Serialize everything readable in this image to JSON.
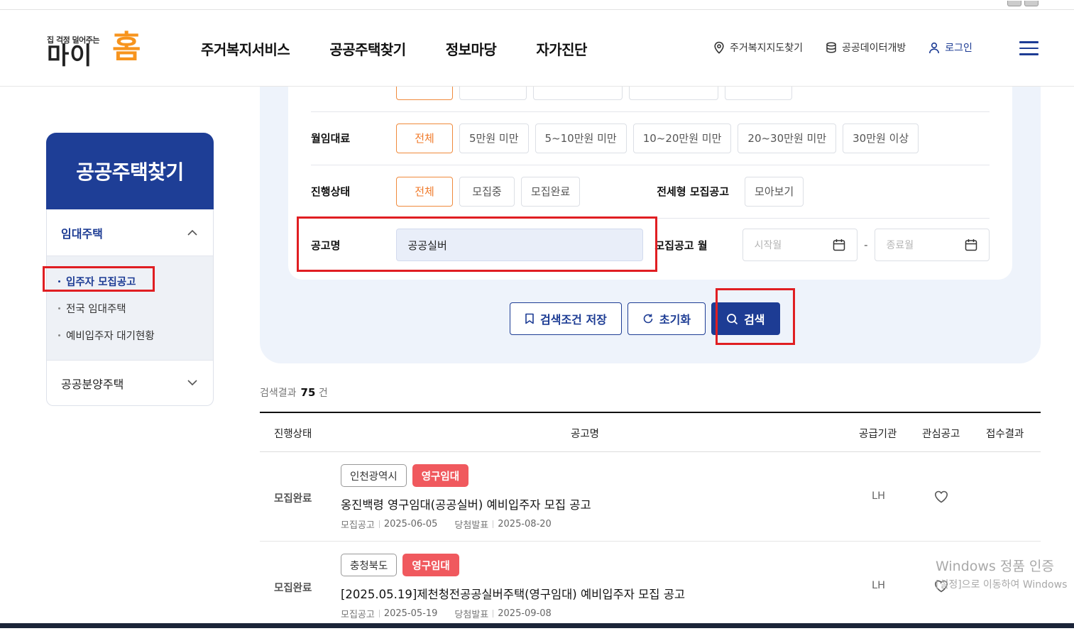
{
  "header": {
    "logo_small": "집 걱정 덜어주는",
    "logo_main": "마이",
    "logo_accent": "홈",
    "nav": [
      "주거복지서비스",
      "공공주택찾기",
      "정보마당",
      "자가진단"
    ],
    "util": {
      "map": "주거복지지도찾기",
      "data": "공공데이터개방",
      "login": "로그인"
    }
  },
  "sidebar": {
    "title": "공공주택찾기",
    "section1": "임대주택",
    "items": [
      "입주자 모집공고",
      "전국 임대주택",
      "예비입주자 대기현황"
    ],
    "section2": "공공분양주택"
  },
  "search": {
    "rent_label": "월임대료",
    "rent_options": [
      "전체",
      "5만원 미만",
      "5~10만원 미만",
      "10~20만원 미만",
      "20~30만원 미만",
      "30만원 이상"
    ],
    "status_label": "진행상태",
    "status_options": [
      "전체",
      "모집중",
      "모집완료"
    ],
    "jeonse_label": "전세형 모집공고",
    "jeonse_button": "모아보기",
    "name_label": "공고명",
    "name_value": "공공실버",
    "month_label": "모집공고 월",
    "start_placeholder": "시작월",
    "end_placeholder": "종료월",
    "dash": "-",
    "save_button": "검색조건 저장",
    "reset_button": "초기화",
    "search_button": "검색"
  },
  "results": {
    "count_label": "검색결과",
    "count": "75",
    "count_unit": "건",
    "columns": [
      "진행상태",
      "공고명",
      "공급기관",
      "관심공고",
      "접수결과"
    ],
    "meta_labels": [
      "모집공고",
      "당첨발표"
    ],
    "rows": [
      {
        "status": "모집완료",
        "region": "인천광역시",
        "type": "영구임대",
        "title": "옹진백령 영구임대(공공실버) 예비입주자 모집 공고",
        "posted": "2025-06-05",
        "announce": "2025-08-20",
        "org": "LH"
      },
      {
        "status": "모집완료",
        "region": "충청북도",
        "type": "영구임대",
        "title": "[2025.05.19]제천청전공공실버주택(영구임대) 예비입주자 모집 공고",
        "posted": "2025-05-19",
        "announce": "2025-09-08",
        "org": "LH"
      }
    ]
  },
  "watermark": {
    "line1": "Windows 정품 인증",
    "line2": "[설정]으로 이동하여 Windows"
  },
  "colors": {
    "brand": "#1e3e96",
    "accent": "#f7941d",
    "chip_active": "#f08a3c",
    "tag_red": "#f0595e",
    "highlight": "#e01e22"
  }
}
